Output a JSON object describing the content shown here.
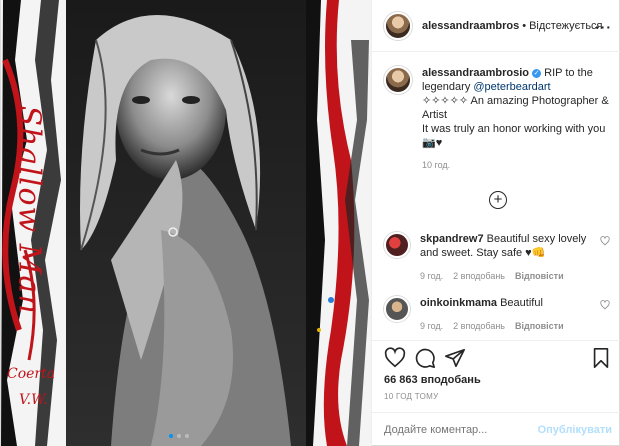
{
  "header": {
    "username": "alessandraambros",
    "separator": "•",
    "follow_status": "Відстежується",
    "more_icon": "more-horizontal-icon"
  },
  "caption": {
    "username": "alessandraambrosio",
    "verified_mark": "✓",
    "text_before": " RIP to the legendary ",
    "mention": "@peterbeardart",
    "line2": "✧✧✧✧✧ An amazing Photographer & Artist",
    "line3": "It was truly an honor working with you",
    "line4": "📷♥",
    "time": "10 год."
  },
  "media": {
    "side_text_left": "Shallow Man",
    "side_text_bottom": "Coerta",
    "side_text_bottom2": "V.W.",
    "carousel_count": 3,
    "carousel_active": 1
  },
  "comments": [
    {
      "username": "skpandrew7",
      "text": " Beautiful sexy lovely and sweet. Stay safe ♥👊",
      "time": "9 год.",
      "likes": "2 вподобань",
      "reply": "Відповісти"
    },
    {
      "username": "oinkoinkmama",
      "text": " Beautiful",
      "time": "9 год.",
      "likes": "2 вподобань",
      "reply": "Відповісти"
    }
  ],
  "footer": {
    "likes": "66 863 вподобань",
    "posted": "10 ГОД ТОМУ",
    "comment_placeholder": "Додайте коментар...",
    "publish_label": "Опублікувати"
  }
}
